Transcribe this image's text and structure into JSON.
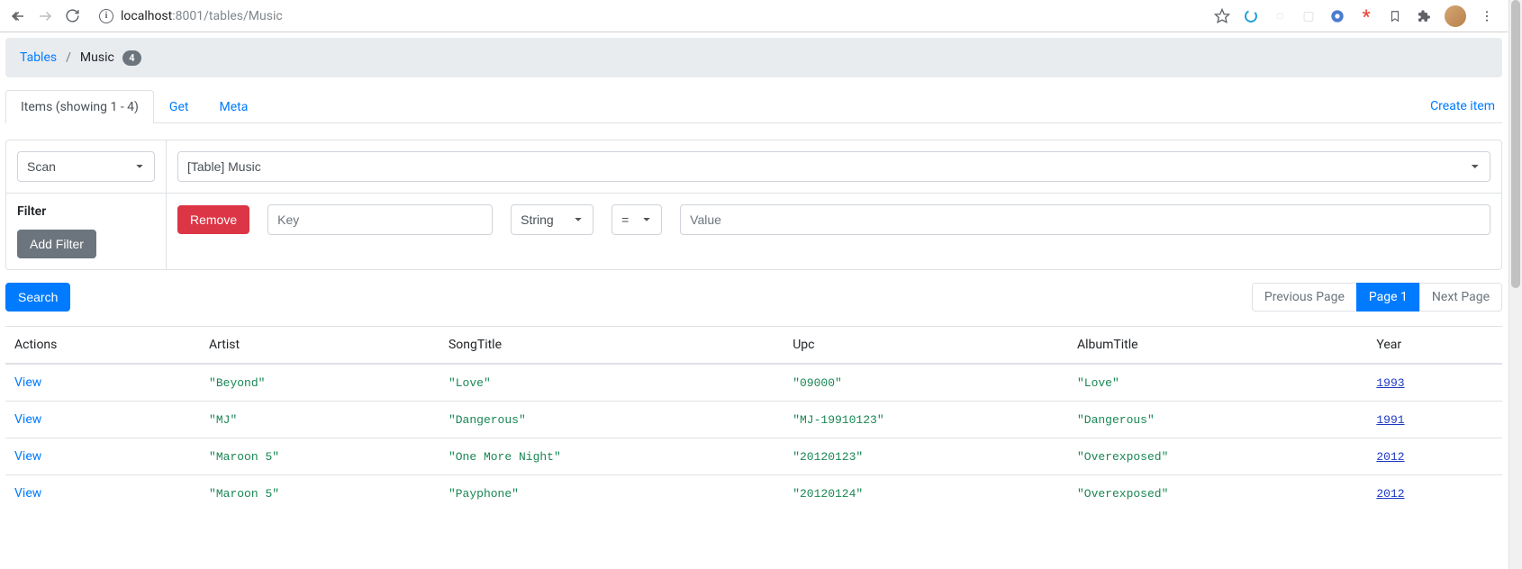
{
  "browser": {
    "url_host": "localhost",
    "url_rest": ":8001/tables/Music"
  },
  "breadcrumb": {
    "root": "Tables",
    "sep": "/",
    "current": "Music",
    "count": "4"
  },
  "tabs": {
    "items_label": "Items (showing 1 - 4)",
    "get_label": "Get",
    "meta_label": "Meta",
    "create_label": "Create item"
  },
  "query": {
    "mode_value": "Scan",
    "target_value": "[Table] Music",
    "filter_heading": "Filter",
    "add_filter_label": "Add Filter",
    "remove_label": "Remove",
    "key_placeholder": "Key",
    "type_value": "String",
    "op_value": "=",
    "value_placeholder": "Value",
    "search_label": "Search"
  },
  "pagination": {
    "prev": "Previous Page",
    "current": "Page 1",
    "next": "Next Page"
  },
  "table": {
    "headers": {
      "actions": "Actions",
      "artist": "Artist",
      "songtitle": "SongTitle",
      "upc": "Upc",
      "albumtitle": "AlbumTitle",
      "year": "Year"
    },
    "view_label": "View",
    "rows": [
      {
        "artist": "\"Beyond\"",
        "songtitle": "\"Love\"",
        "upc": "\"09000\"",
        "albumtitle": "\"Love\"",
        "year": "1993"
      },
      {
        "artist": "\"MJ\"",
        "songtitle": "\"Dangerous\"",
        "upc": "\"MJ-19910123\"",
        "albumtitle": "\"Dangerous\"",
        "year": "1991"
      },
      {
        "artist": "\"Maroon 5\"",
        "songtitle": "\"One More Night\"",
        "upc": "\"20120123\"",
        "albumtitle": "\"Overexposed\"",
        "year": "2012"
      },
      {
        "artist": "\"Maroon 5\"",
        "songtitle": "\"Payphone\"",
        "upc": "\"20120124\"",
        "albumtitle": "\"Overexposed\"",
        "year": "2012"
      }
    ]
  }
}
